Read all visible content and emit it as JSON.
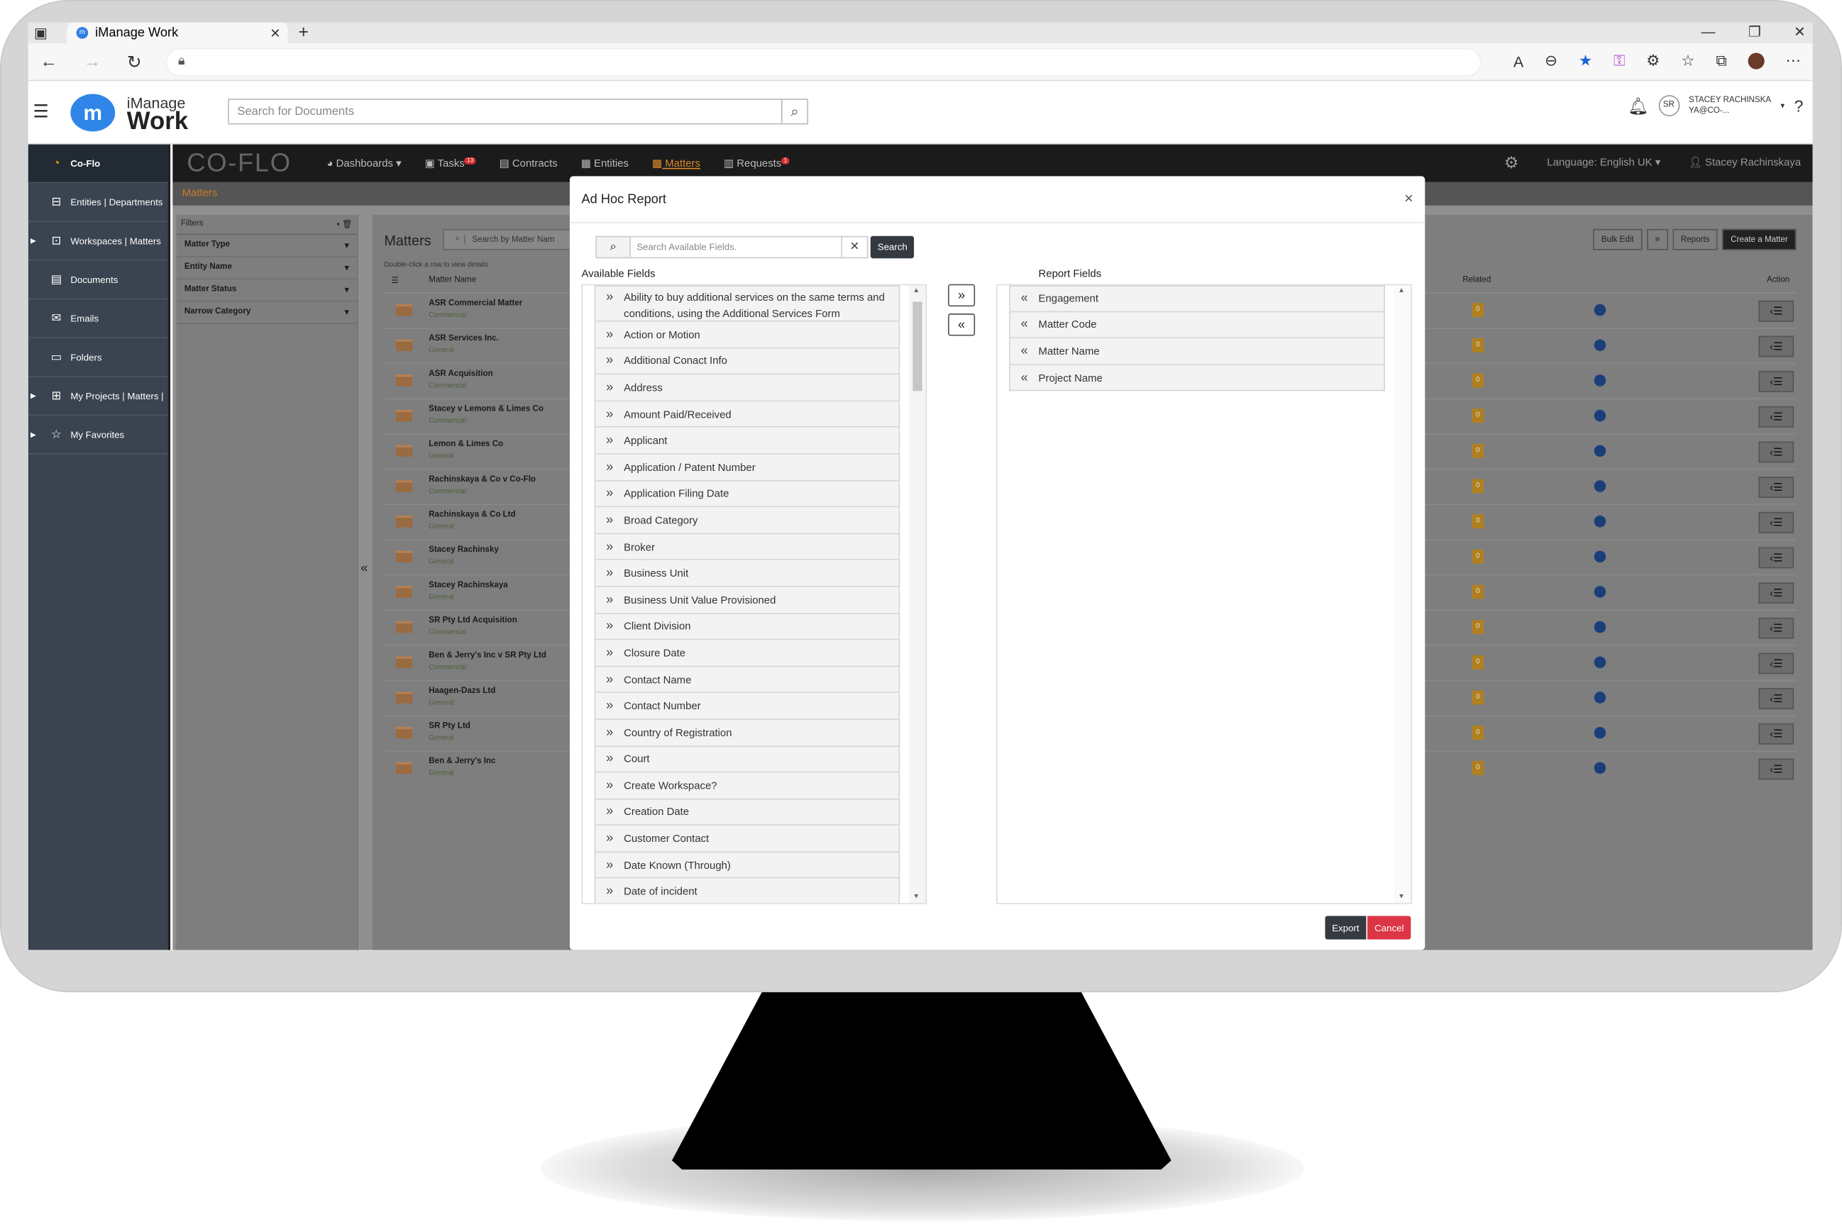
{
  "browser": {
    "tab_title": "iManage Work",
    "tab_close": "✕",
    "new_tab": "+",
    "window_controls": [
      "—",
      "❐",
      "✕"
    ]
  },
  "imanage": {
    "logo_small": "iManage",
    "logo_large": "Work",
    "doc_search_placeholder": "Search for Documents",
    "user_initials": "SR",
    "user_name_line1": "STACEY RACHINSKA",
    "user_name_line2": "YA@CO-..."
  },
  "sidebar": {
    "items": [
      {
        "label": "Co-Flo",
        "icon": "coflo-icon"
      },
      {
        "label": "Entities | Departments",
        "icon": "briefcase-icon"
      },
      {
        "label": "Workspaces | Matters",
        "icon": "workspace-icon"
      },
      {
        "label": "Documents",
        "icon": "document-icon"
      },
      {
        "label": "Emails",
        "icon": "email-icon"
      },
      {
        "label": "Folders",
        "icon": "folder-icon"
      },
      {
        "label": "My Projects | Matters |",
        "icon": "projects-icon"
      },
      {
        "label": "My Favorites",
        "icon": "star-icon"
      }
    ]
  },
  "coflo": {
    "brand": "CO-FLO",
    "menu": [
      {
        "label": "Dashboards ▾",
        "badge": ""
      },
      {
        "label": "Tasks",
        "badge": "13"
      },
      {
        "label": "Contracts",
        "badge": ""
      },
      {
        "label": "Entities",
        "badge": ""
      },
      {
        "label": "Matters",
        "badge": ""
      },
      {
        "label": "Requests",
        "badge": "1"
      }
    ],
    "language": "Language: English UK ▾",
    "user": "Stacey Rachinskaya",
    "breadcrumb": "Matters",
    "filters": {
      "title": "Filters",
      "items": [
        "Matter Type",
        "Entity Name",
        "Matter Status",
        "Narrow Category"
      ]
    },
    "matters": {
      "title": "Matters",
      "search_placeholder": "Search by Matter Nam",
      "hint": "Double-click a row to view details",
      "col_name": "Matter Name",
      "col_related": "Related",
      "col_action": "Action",
      "buttons": {
        "bulk_edit": "Bulk Edit",
        "reports": "Reports",
        "create": "Create a Matter"
      },
      "rows": [
        {
          "name": "ASR Commercial Matter",
          "category": "Commercial",
          "related": "0"
        },
        {
          "name": "ASR Services Inc.",
          "category": "General",
          "related": "0"
        },
        {
          "name": "ASR Acquisition",
          "category": "Commercial",
          "related": "0"
        },
        {
          "name": "Stacey v Lemons & Limes Co",
          "category": "Commercial",
          "related": "0"
        },
        {
          "name": "Lemon & Limes Co",
          "category": "General",
          "related": "0"
        },
        {
          "name": "Rachinskaya & Co v Co-Flo",
          "category": "Commercial",
          "related": "0"
        },
        {
          "name": "Rachinskaya & Co Ltd",
          "category": "General",
          "related": "0"
        },
        {
          "name": "Stacey Rachinsky",
          "category": "General",
          "related": "0"
        },
        {
          "name": "Stacey Rachinskaya",
          "category": "General",
          "related": "0"
        },
        {
          "name": "SR Pty Ltd Acquisition",
          "category": "Commercial",
          "related": "0"
        },
        {
          "name": "Ben & Jerry's Inc v SR Pty Ltd",
          "category": "Commercial",
          "related": "0"
        },
        {
          "name": "Haagen-Dazs Ltd",
          "category": "General",
          "related": "0"
        },
        {
          "name": "SR Pty Ltd",
          "category": "General",
          "related": "0"
        },
        {
          "name": "Ben & Jerry's Inc",
          "category": "General",
          "related": "0"
        }
      ]
    }
  },
  "modal": {
    "title": "Ad Hoc Report",
    "close": "×",
    "search_placeholder": "Search Available Fields.",
    "search_button": "Search",
    "available_label": "Available Fields",
    "report_label": "Report Fields",
    "move_right": "»",
    "move_left": "«",
    "available_fields": [
      "Ability to buy additional services on the same terms and conditions, using the Additional Services Form",
      "Action or Motion",
      "Additional Conact Info",
      "Address",
      "Amount Paid/Received",
      "Applicant",
      "Application / Patent Number",
      "Application Filing Date",
      "Broad Category",
      "Broker",
      "Business Unit",
      "Business Unit Value Provisioned",
      "Client Division",
      "Closure Date",
      "Contact Name",
      "Contact Number",
      "Country of Registration",
      "Court",
      "Create Workspace?",
      "Creation Date",
      "Customer Contact",
      "Date Known (Through)",
      "Date of incident"
    ],
    "report_fields": [
      "Engagement",
      "Matter Code",
      "Matter Name",
      "Project Name"
    ],
    "export": "Export",
    "cancel": "Cancel"
  }
}
